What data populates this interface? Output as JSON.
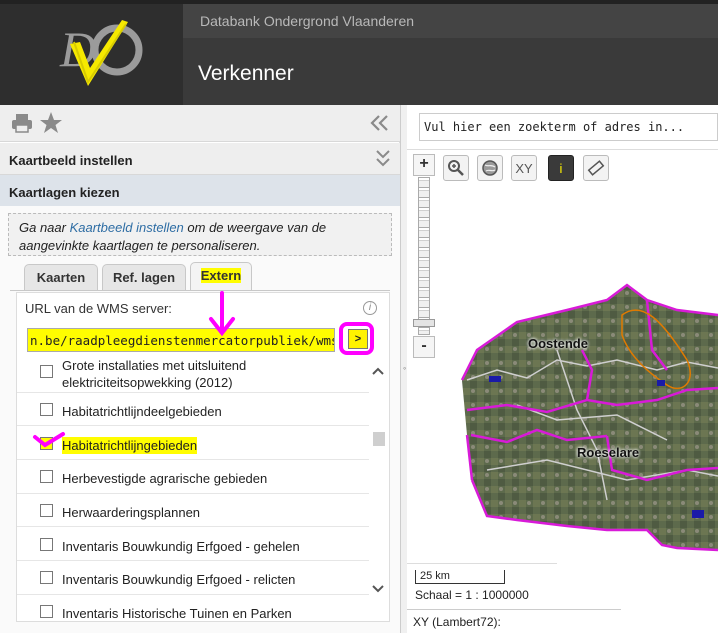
{
  "header": {
    "subtitle": "Databank Ondergrond Vlaanderen",
    "title": "Verkenner",
    "logo_text": "DOV"
  },
  "toolbar": {
    "print_icon": "printer-icon",
    "favorite_icon": "star-icon",
    "collapse_icon": "double-chevron-left-icon"
  },
  "accordion": {
    "section1": "Kaartbeeld instellen",
    "section2": "Kaartlagen kiezen"
  },
  "info": {
    "prefix": "Ga naar ",
    "link": "Kaartbeeld instellen",
    "suffix": " om de weergave van de aangevinkte kaartlagen te personaliseren."
  },
  "tabs": [
    {
      "label": "Kaarten"
    },
    {
      "label": "Ref. lagen"
    },
    {
      "label": "Extern"
    }
  ],
  "wms": {
    "label": "URL van de WMS server:",
    "url": "n.be/raadpleegdienstenmercatorpubliek/wms?",
    "go_label": ">"
  },
  "layers": [
    {
      "label": "Grote installaties met uitsluitend elektriciteitsopwekking (2012)"
    },
    {
      "label": "Habitatrichtlijndeelgebieden"
    },
    {
      "label": "Habitatrichtlijngebieden"
    },
    {
      "label": "Herbevestigde agrarische gebieden"
    },
    {
      "label": "Herwaarderingsplannen"
    },
    {
      "label": "Inventaris Bouwkundig Erfgoed - gehelen"
    },
    {
      "label": "Inventaris Bouwkundig Erfgoed - relicten"
    },
    {
      "label": "Inventaris Historische Tuinen en Parken"
    }
  ],
  "map": {
    "search_placeholder": "Vul hier een zoekterm of adres in...",
    "zoom_in": "+",
    "zoom_out": "-",
    "tools": [
      "zoom-box-icon",
      "globe-icon",
      "XY",
      "i",
      "ruler-icon"
    ],
    "xy_label": "XY",
    "info_label": "i",
    "cities": [
      "Oostende",
      "Roeselare"
    ],
    "scale_bar": "25 km",
    "scale_text": "Schaal = 1 : 1000000",
    "coord_text": "XY (Lambert72):"
  },
  "colors": {
    "brand_yellow": "#fff200",
    "highlight_magenta": "#ff00ff",
    "header_dark": "#3a3a3a",
    "boundary": "#d81ad8"
  }
}
